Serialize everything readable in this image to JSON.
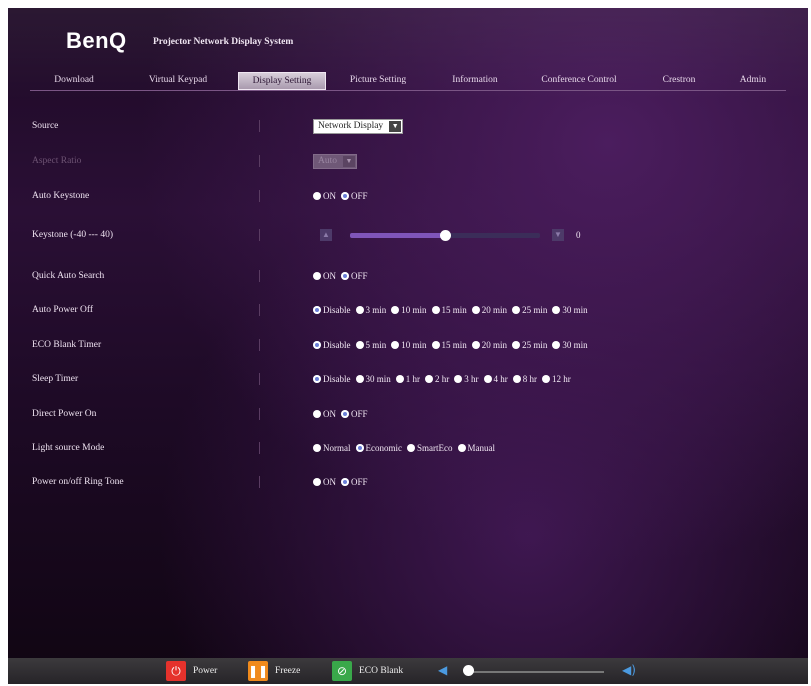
{
  "header": {
    "logo": "BenQ",
    "title": "Projector Network Display System"
  },
  "tabs": [
    "Download",
    "Virtual Keypad",
    "Display Setting",
    "Picture Setting",
    "Information",
    "Conference Control",
    "Crestron",
    "Admin"
  ],
  "active_tab": "Display Setting",
  "settings": {
    "source": {
      "label": "Source",
      "value": "Network Display"
    },
    "aspect_ratio": {
      "label": "Aspect Ratio",
      "value": "Auto"
    },
    "auto_keystone": {
      "label": "Auto Keystone",
      "options": [
        "ON",
        "OFF"
      ],
      "selected": "OFF"
    },
    "keystone": {
      "label": "Keystone (-40 --- 40)",
      "value": "0"
    },
    "quick_auto_search": {
      "label": "Quick Auto Search",
      "options": [
        "ON",
        "OFF"
      ],
      "selected": "OFF"
    },
    "auto_power_off": {
      "label": "Auto Power Off",
      "options": [
        "Disable",
        "3 min",
        "10 min",
        "15 min",
        "20 min",
        "25 min",
        "30 min"
      ],
      "selected": "Disable"
    },
    "eco_blank_timer": {
      "label": "ECO Blank Timer",
      "options": [
        "Disable",
        "5 min",
        "10 min",
        "15 min",
        "20 min",
        "25 min",
        "30 min"
      ],
      "selected": "Disable"
    },
    "sleep_timer": {
      "label": "Sleep Timer",
      "options": [
        "Disable",
        "30 min",
        "1 hr",
        "2 hr",
        "3 hr",
        "4 hr",
        "8 hr",
        "12 hr"
      ],
      "selected": "Disable"
    },
    "direct_power_on": {
      "label": "Direct Power On",
      "options": [
        "ON",
        "OFF"
      ],
      "selected": "OFF"
    },
    "light_source_mode": {
      "label": "Light source Mode",
      "options": [
        "Normal",
        "Economic",
        "SmartEco",
        "Manual"
      ],
      "selected": "Economic"
    },
    "power_ring_tone": {
      "label": "Power on/off Ring Tone",
      "options": [
        "ON",
        "OFF"
      ],
      "selected": "OFF"
    }
  },
  "footer": {
    "power": "Power",
    "freeze": "Freeze",
    "eco_blank": "ECO Blank",
    "volume_level": 0.0
  }
}
